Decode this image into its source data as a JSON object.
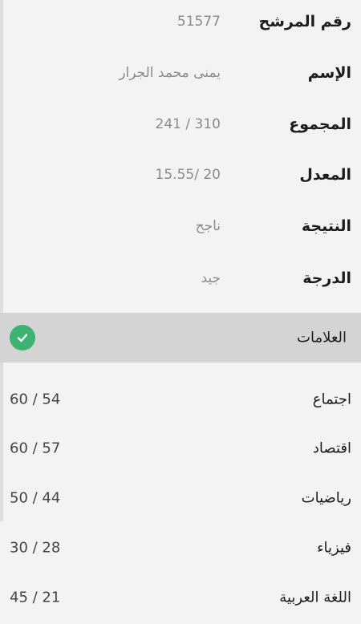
{
  "info": [
    {
      "label": "رقم المرشح",
      "value": "51577"
    },
    {
      "label": "الإسم",
      "value": "يمنى محمد الجرار"
    },
    {
      "label": "المجموع",
      "value": "310 / 241"
    },
    {
      "label": "المعدل",
      "value": "20 /15.55"
    },
    {
      "label": "النتيجة",
      "value": "ناجح"
    },
    {
      "label": "الدرجة",
      "value": "جيد"
    }
  ],
  "marks_header": {
    "title": "العلامات",
    "icon": "check-circle-icon",
    "icon_color": "#3cb371"
  },
  "subjects": [
    {
      "name": "اجتماع",
      "score": "60 / 54"
    },
    {
      "name": "اقتصاد",
      "score": "60 / 57"
    },
    {
      "name": "رياضيات",
      "score": "50 / 44"
    },
    {
      "name": "فيزياء",
      "score": "30 / 28"
    },
    {
      "name": "اللغة العربية",
      "score": "45 / 21"
    }
  ]
}
